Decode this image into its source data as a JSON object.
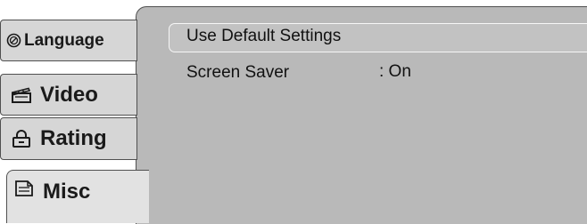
{
  "tabs": [
    {
      "label": "Language",
      "icon": "language-icon"
    },
    {
      "label": "Video",
      "icon": "video-icon"
    },
    {
      "label": "Rating",
      "icon": "lock-icon"
    },
    {
      "label": "Misc",
      "icon": "document-icon"
    }
  ],
  "misc": {
    "default_settings": "Use Default Settings",
    "screen_saver_label": "Screen Saver",
    "screen_saver_value": ": On"
  },
  "colors": {
    "panel": "#b9b9b9",
    "tab": "#d6d6d6",
    "active_tab": "#e2e2e2"
  }
}
